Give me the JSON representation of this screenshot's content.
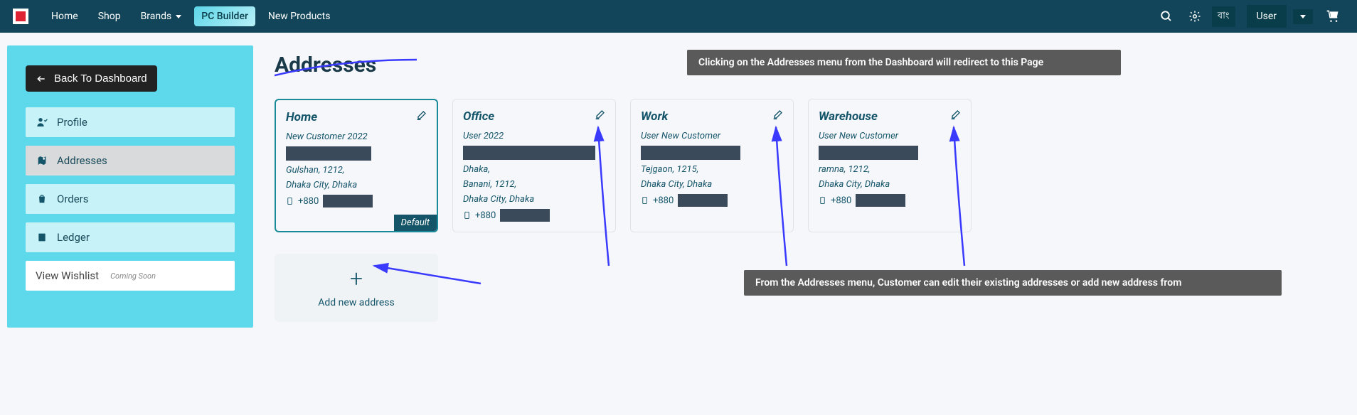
{
  "nav": {
    "links": [
      "Home",
      "Shop",
      "Brands",
      "PC Builder",
      "New Products"
    ],
    "lang": "বাং",
    "user": "User"
  },
  "sidebar": {
    "back": "Back To Dashboard",
    "items": [
      {
        "label": "Profile"
      },
      {
        "label": "Addresses"
      },
      {
        "label": "Orders"
      },
      {
        "label": "Ledger"
      }
    ],
    "wishlist": "View Wishlist",
    "soon": "Coming Soon"
  },
  "page": {
    "title": "Addresses",
    "add_new": "Add new address",
    "default_badge": "Default"
  },
  "addresses": [
    {
      "title": "Home",
      "name": "New Customer 2022",
      "line1": "Gulshan, 1212,",
      "line2": "Dhaka City, Dhaka",
      "phone_prefix": "+880",
      "is_default": true
    },
    {
      "title": "Office",
      "name": "User 2022",
      "line1": "Dhaka,",
      "line2": "Banani, 1212,",
      "line3": "Dhaka City, Dhaka",
      "phone_prefix": "+880",
      "is_default": false
    },
    {
      "title": "Work",
      "name": "User New Customer",
      "line1": "Tejgaon, 1215,",
      "line2": "Dhaka City, Dhaka",
      "phone_prefix": "+880",
      "is_default": false
    },
    {
      "title": "Warehouse",
      "name": "User New Customer",
      "line1": "ramna, 1212,",
      "line2": "Dhaka City, Dhaka",
      "phone_prefix": "+880",
      "is_default": false
    }
  ],
  "callouts": {
    "c1": "Clicking on the Addresses menu from the Dashboard will redirect to this Page",
    "c2": "From the Addresses menu, Customer can edit their existing addresses or add new address from"
  }
}
